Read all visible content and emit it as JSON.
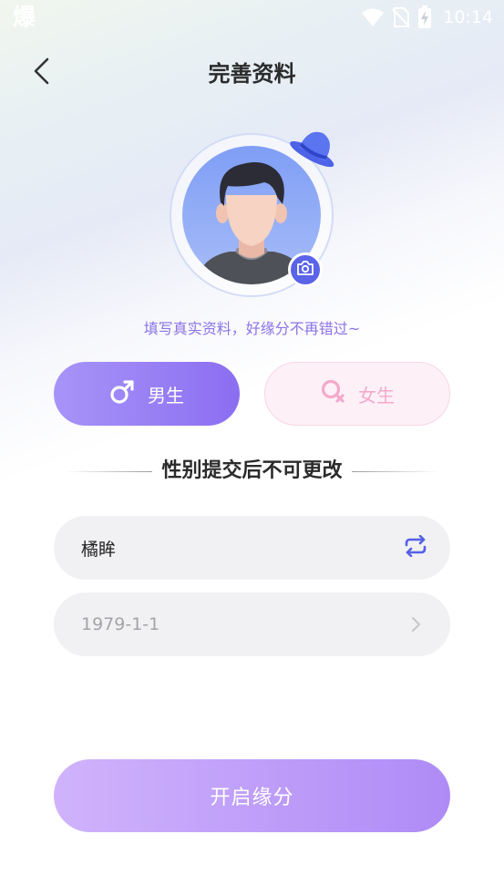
{
  "status_bar": {
    "app_icon": "爆",
    "time": "10:14",
    "icons": [
      "wifi-icon",
      "no-sim-icon",
      "battery-charging-icon"
    ]
  },
  "header": {
    "title": "完善资料",
    "back_icon": "chevron-left-icon"
  },
  "avatar": {
    "decoration_icon": "hat-icon",
    "camera_icon": "camera-icon"
  },
  "hint": "填写真实资料，好缘分不再错过~",
  "gender": {
    "male_label": "男生",
    "female_label": "女生",
    "selected": "male",
    "male_icon": "male-symbol-icon",
    "female_icon": "female-symbol-icon"
  },
  "notice": "性别提交后不可更改",
  "form": {
    "nickname_value": "橘眸",
    "nickname_action_icon": "refresh-icon",
    "birthday_value": "1979-1-1",
    "birthday_action_icon": "chevron-right-icon"
  },
  "submit_label": "开启缘分",
  "colors": {
    "accent": "#8b6ef1",
    "male_button": "#9a82f5",
    "female_button": "#fdf1f7",
    "female_text": "#f4a9cc",
    "hint_text": "#8b73e6",
    "submit_start": "#d0b3fc",
    "submit_end": "#ae8bf6"
  }
}
